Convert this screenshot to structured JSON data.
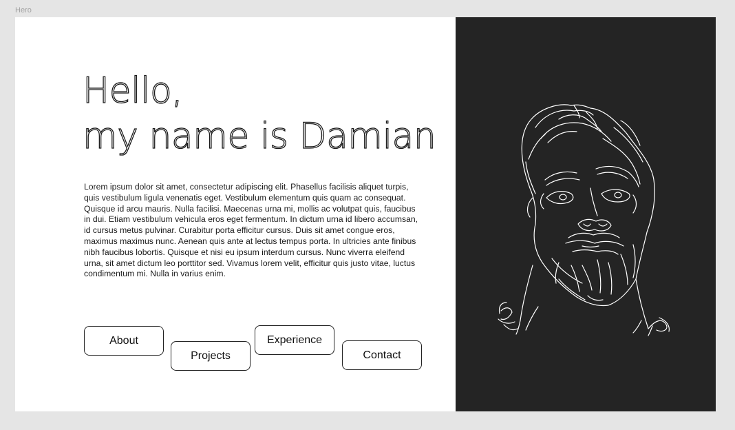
{
  "frame": {
    "label": "Hero"
  },
  "hero": {
    "headline_line1": "Hello,",
    "headline_line2": "my name is Damian",
    "bio": "Lorem ipsum dolor sit amet, consectetur adipiscing elit. Phasellus facilisis aliquet turpis, quis vestibulum ligula venenatis eget. Vestibulum elementum quis quam ac consequat. Quisque id arcu mauris. Nulla facilisi. Maecenas urna mi, mollis ac volutpat quis, faucibus in dui. Etiam vestibulum vehicula eros eget fermentum. In dictum urna id libero accumsan, id cursus metus pulvinar. Curabitur porta efficitur cursus. Duis sit amet congue eros, maximus maximus nunc. Aenean quis ante at lectus tempus porta. In ultricies ante finibus nibh faucibus lobortis. Quisque et nisi eu ipsum interdum cursus. Nunc viverra eleifend urna, sit amet dictum leo porttitor sed. Vivamus lorem velit, efficitur quis justo vitae, luctus condimentum mi. Nulla in varius enim."
  },
  "nav": {
    "about": "About",
    "projects": "Projects",
    "experience": "Experience",
    "contact": "Contact"
  },
  "portrait": {
    "icon": "line-art-portrait"
  },
  "colors": {
    "page_bg": "#e5e5e5",
    "panel_bg": "#ffffff",
    "portrait_bg": "#242424",
    "ink": "#1a1a1a"
  }
}
